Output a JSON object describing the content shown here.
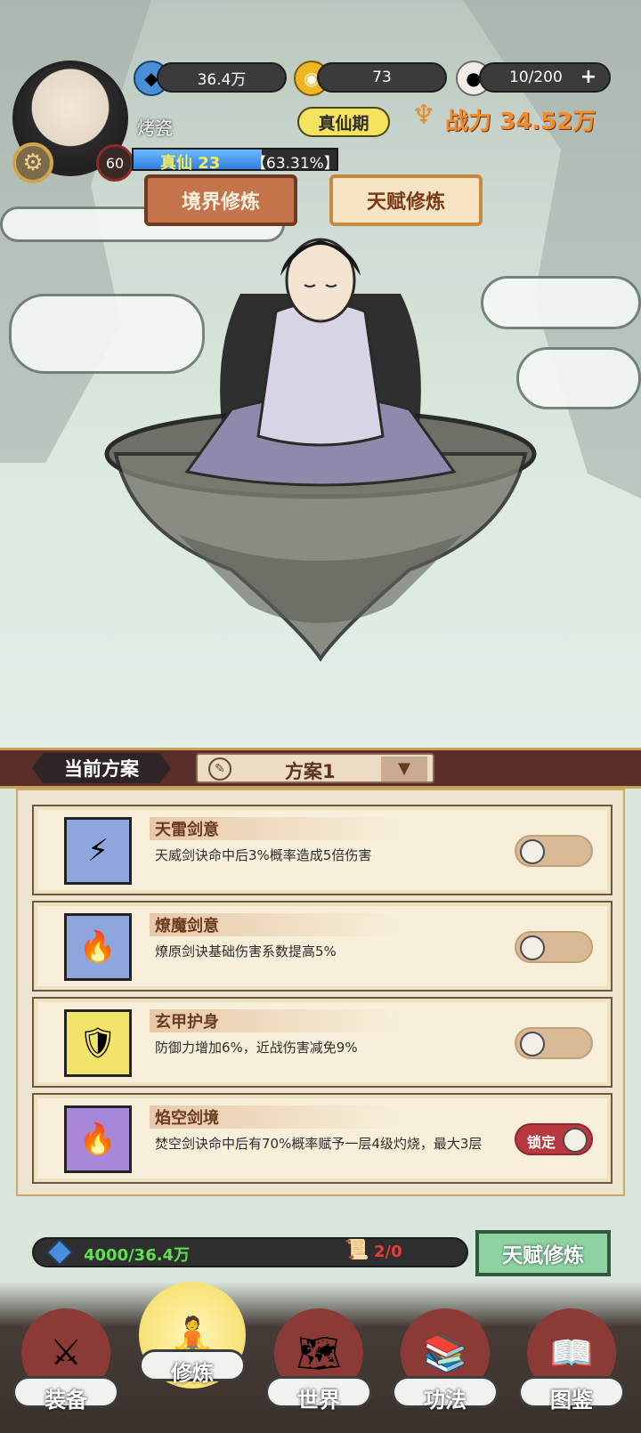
{
  "top": {
    "spirit_stones": "36.4万",
    "gold": "73",
    "stamina": "10/200",
    "player_name": "烤瓷",
    "realm_badge": "真仙期",
    "power_label": "战力",
    "power_value": "34.52万",
    "level": "60",
    "realm_level": "真仙 23",
    "exp_percent_text": "【63.31%】",
    "exp_progress": 0.6331
  },
  "tabs": {
    "realm_training": "境界修炼",
    "talent_training": "天赋修炼"
  },
  "plan": {
    "current_label": "当前方案",
    "selected": "方案1"
  },
  "skills": [
    {
      "title": "天雷剑意",
      "desc": "天威剑诀命中后3%概率造成5倍伤害",
      "toggle": false,
      "color": "#8ea6de",
      "icon": "🔥"
    },
    {
      "title": "燎魔剑意",
      "desc": "燎原剑诀基础伤害系数提高5%",
      "toggle": false,
      "color": "#8ea6de",
      "icon": "🔥"
    },
    {
      "title": "玄甲护身",
      "desc": "防御力增加6%，近战伤害减免9%",
      "toggle": false,
      "color": "#f2e36b",
      "icon": "🛡"
    },
    {
      "title": "焰空剑境",
      "desc": "焚空剑诀命中后有70%概率赋予一层4级灼烧，最大3层",
      "toggle": true,
      "toggle_label": "锁定",
      "color": "#a787d9",
      "icon": "🔥"
    }
  ],
  "bottom": {
    "stones_text": "4000/36.4万",
    "scroll_text": "2/0",
    "action_button": "天赋修炼"
  },
  "nav": [
    {
      "label": "装备",
      "icon": "sword-armor-icon"
    },
    {
      "label": "修炼",
      "icon": "cultivator-icon"
    },
    {
      "label": "世界",
      "icon": "scroll-map-icon"
    },
    {
      "label": "功法",
      "icon": "books-icon"
    },
    {
      "label": "图鉴",
      "icon": "open-book-icon"
    }
  ]
}
